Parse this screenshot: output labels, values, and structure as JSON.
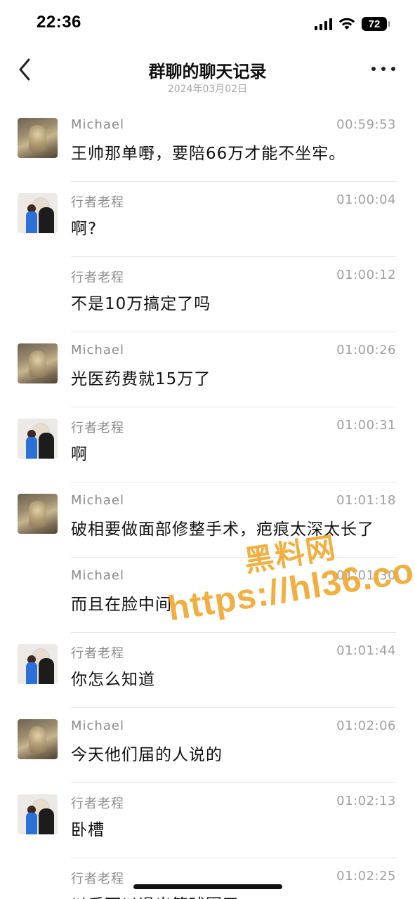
{
  "status_bar": {
    "time": "22:36",
    "battery": "72",
    "icons": [
      "signal-icon",
      "wifi-icon",
      "battery-icon"
    ]
  },
  "nav": {
    "title": "群聊的聊天记录",
    "subtitle": "2024年03月02日",
    "back_icon": "chevron-left-icon",
    "more_icon": "more-dots-icon"
  },
  "messages": [
    {
      "sender": "Michael",
      "time": "00:59:53",
      "text": "王帅那单嘢，要陪66万才能不坐牢。",
      "avatar": "michael"
    },
    {
      "sender": "行者老程",
      "time": "01:00:04",
      "text": "啊?",
      "avatar": "laocheng"
    },
    {
      "sender": "行者老程",
      "time": "01:00:12",
      "text": "不是10万搞定了吗",
      "avatar": ""
    },
    {
      "sender": "Michael",
      "time": "01:00:26",
      "text": "光医药费就15万了",
      "avatar": "michael"
    },
    {
      "sender": "行者老程",
      "time": "01:00:31",
      "text": "啊",
      "avatar": "laocheng"
    },
    {
      "sender": "Michael",
      "time": "01:01:18",
      "text": "破相要做面部修整手术，疤痕太深太长了",
      "avatar": "michael"
    },
    {
      "sender": "Michael",
      "time": "01:01:30",
      "text": "而且在脸中间",
      "avatar": ""
    },
    {
      "sender": "行者老程",
      "time": "01:01:44",
      "text": "你怎么知道",
      "avatar": "laocheng"
    },
    {
      "sender": "Michael",
      "time": "01:02:06",
      "text": "今天他们届的人说的",
      "avatar": "michael"
    },
    {
      "sender": "行者老程",
      "time": "01:02:13",
      "text": "卧槽",
      "avatar": "laocheng"
    },
    {
      "sender": "行者老程",
      "time": "01:02:25",
      "text": "以后可以退出篮球圈了",
      "avatar": ""
    }
  ],
  "watermark": {
    "line1": "黑料网",
    "line2": "https://hl36.co"
  },
  "colors": {
    "watermark": "#f0a21f",
    "meta_text": "#8a8a8a",
    "divider": "#e6e6e6"
  }
}
